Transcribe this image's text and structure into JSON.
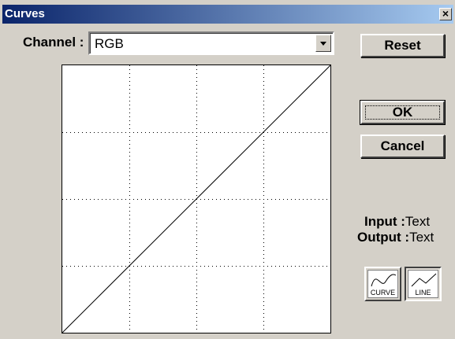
{
  "window": {
    "title": "Curves",
    "close_glyph": "×"
  },
  "channel": {
    "label": "Channel :",
    "value": "RGB"
  },
  "buttons": {
    "reset": "Reset",
    "ok": "OK",
    "cancel": "Cancel"
  },
  "readout": {
    "input_label": "Input :",
    "input_value": "Text",
    "output_label": "Output :",
    "output_value": "Text"
  },
  "modes": {
    "curve": "CURVE",
    "line": "LINE",
    "active": "line"
  },
  "graph": {
    "grid_divisions": 4,
    "curve_points": [
      [
        0,
        0
      ],
      [
        255,
        255
      ]
    ],
    "input_range": [
      0,
      255
    ],
    "output_range": [
      0,
      255
    ]
  },
  "colors": {
    "titlebar_start": "#0a246a",
    "titlebar_end": "#a6caf0",
    "face": "#d4d0c8"
  }
}
